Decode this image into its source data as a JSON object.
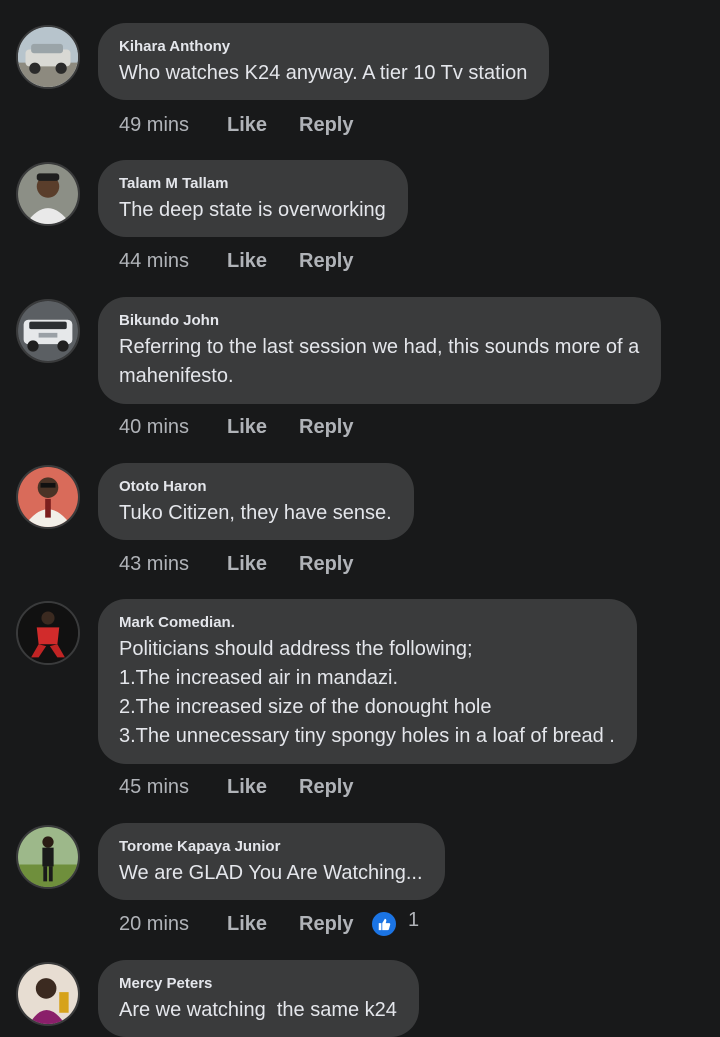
{
  "comments": [
    {
      "author": "Kihara Anthony",
      "lines": [
        "Who watches K24 anyway. A tier 10 Tv station"
      ],
      "time": "49 mins",
      "like": "Like",
      "reply": "Reply"
    },
    {
      "author": "Talam M Tallam",
      "lines": [
        "The deep state is overworking"
      ],
      "time": "44 mins",
      "like": "Like",
      "reply": "Reply"
    },
    {
      "author": "Bikundo John",
      "lines": [
        "Referring to the last session we had, this sounds more of a",
        "mahenifesto."
      ],
      "time": "40 mins",
      "like": "Like",
      "reply": "Reply"
    },
    {
      "author": "Ototo Haron",
      "lines": [
        "Tuko Citizen, they have sense."
      ],
      "time": "43 mins",
      "like": "Like",
      "reply": "Reply"
    },
    {
      "author": "Mark Comedian.",
      "lines": [
        "Politicians should address the following;",
        "1.The increased air in mandazi.",
        "2.The increased size of the donought hole",
        "3.The unnecessary tiny spongy holes in a loaf of bread ."
      ],
      "time": "45 mins",
      "like": "Like",
      "reply": "Reply"
    },
    {
      "author": "Torome Kapaya Junior",
      "lines": [
        "We are GLAD You Are Watching..."
      ],
      "time": "20 mins",
      "like": "Like",
      "reply": "Reply",
      "reaction_icon": "like-icon",
      "reaction_count": "1"
    },
    {
      "author": "Mercy Peters",
      "lines": [
        "Are we watching  the same k24"
      ]
    }
  ],
  "colors": {
    "background": "#18191a",
    "bubble": "#3a3b3c",
    "text": "#e4e6eb",
    "secondary_text": "#b0b3b8",
    "like_blue": "#1b74e4"
  }
}
